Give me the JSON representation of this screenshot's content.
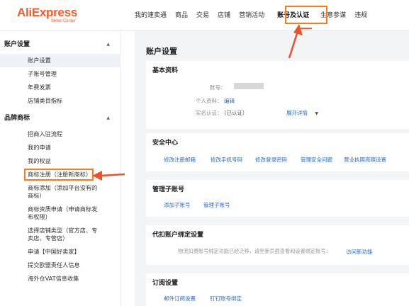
{
  "logo": {
    "main": "AliExpress",
    "sub": "Seller Center"
  },
  "topnav": [
    "我的速卖通",
    "商品",
    "交易",
    "店铺",
    "营销活动",
    "账号及认证",
    "生意参谋",
    "违规"
  ],
  "sidebar": {
    "section1": "账户设置",
    "section1_items": [
      "账户设置",
      "子账号管理",
      "年费发票",
      "店铺类目指标"
    ],
    "section2": "品牌商标",
    "section2_items": [
      "招商入驻流程",
      "我的申请",
      "我的权益",
      "商标注册（注册新商标）",
      "商标添加（添加平台没有的商标）",
      "商标资质申请（申请商标发布权限）",
      "选择店铺类型（官方店、专卖店、专营店）",
      "申请【中国好卖家】",
      "提交欧盟责任人信息",
      "海外仓VAT信息收集"
    ]
  },
  "main": {
    "title": "账户设置",
    "basic": {
      "title": "基本资料",
      "account_label": "账号：",
      "profile_label": "个人资料：",
      "profile_link": "编辑",
      "verify_label": "实名认证：",
      "verify_value": "（已认证）",
      "expand": "展开详情"
    },
    "security": {
      "title": "安全中心",
      "links": [
        "修改注册邮箱",
        "修改手机号码",
        "修改登录密码",
        "管理安全问题",
        "营业执照亮照设置"
      ]
    },
    "subaccount": {
      "title": "管理子账号",
      "links": [
        "添加子账号",
        "管理子账号"
      ]
    },
    "agent": {
      "title": "代扣账户绑定设置",
      "desc": "物流扣费账号绑定功能已经迁移，请至新页面查看和设置绑定账号：",
      "link": "访问新功能"
    },
    "subscribe": {
      "title": "订阅设置",
      "links": [
        "邮件订阅设置",
        "钉钉账号绑定"
      ]
    }
  },
  "colors": {
    "brand": "#f45c2c",
    "annotation": "#ff7a1a",
    "link": "#2a6acb",
    "annotation_arrow": "#f0502a"
  }
}
